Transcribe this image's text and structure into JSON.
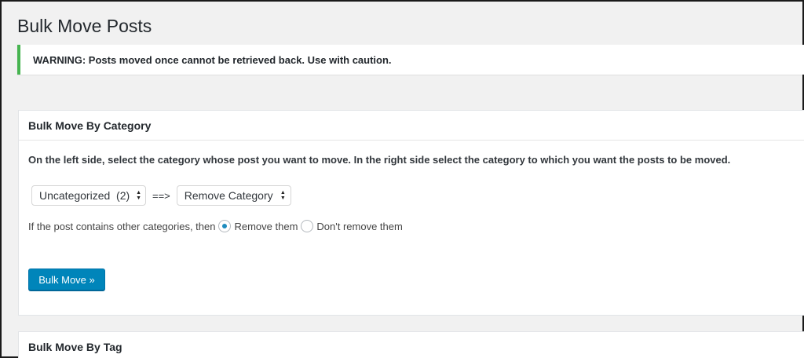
{
  "page": {
    "title": "Bulk Move Posts"
  },
  "notice": {
    "text": "WARNING: Posts moved once cannot be retrieved back. Use with caution."
  },
  "by_category": {
    "title": "Bulk Move By Category",
    "description": "On the left side, select the category whose post you want to move. In the right side select the category to which you want the posts to be moved.",
    "from_select": {
      "value": "Uncategorized  (2)"
    },
    "arrow": "==>",
    "to_select": {
      "value": "Remove Category"
    },
    "radio_prompt": "If the post contains other categories, then",
    "radio_options": [
      {
        "label": "Remove them",
        "checked": true
      },
      {
        "label": "Don't remove them",
        "checked": false
      }
    ],
    "button_label": "Bulk Move »"
  },
  "by_tag": {
    "title": "Bulk Move By Tag"
  },
  "colors": {
    "accent": "#0085ba",
    "notice_border": "#46b450",
    "radio_dot": "#1e8cbe"
  }
}
